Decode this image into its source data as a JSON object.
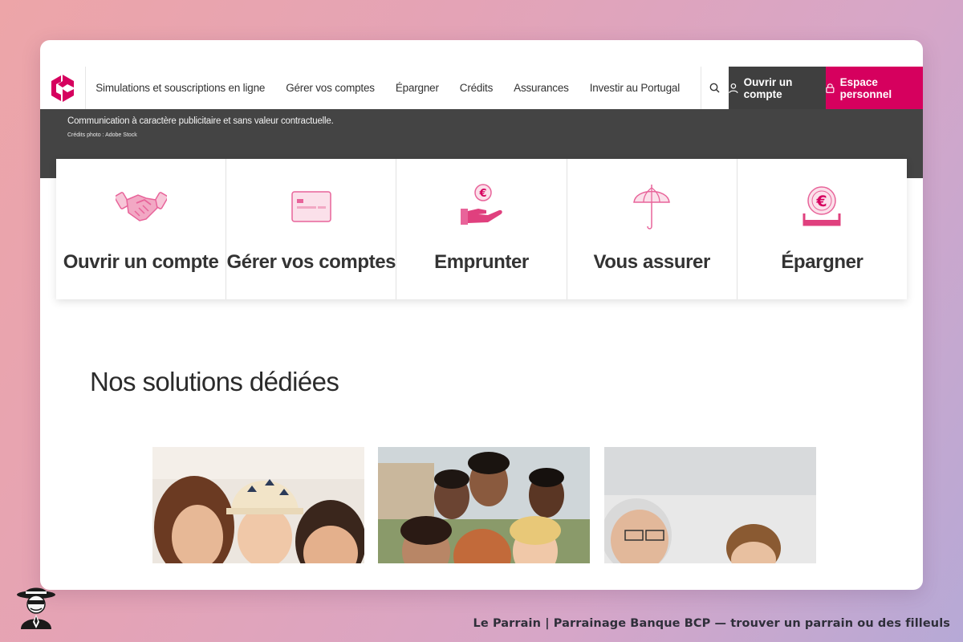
{
  "header": {
    "logo_icon": "bcp-logo-icon",
    "nav": [
      {
        "label": "Simulations et souscriptions en ligne"
      },
      {
        "label": "Gérer vos comptes"
      },
      {
        "label": "Épargner"
      },
      {
        "label": "Crédits"
      },
      {
        "label": "Assurances"
      },
      {
        "label": "Investir au Portugal"
      }
    ],
    "search_icon": "search-icon",
    "open_account_label": "Ouvrir un compte",
    "open_account_icon": "user-icon",
    "espace_label": "Espace personnel",
    "espace_icon": "lock-icon"
  },
  "hero": {
    "disclaimer": "Communication à caractère publicitaire et sans valeur contractuelle.",
    "credit": "Crédits photo : Adobe Stock"
  },
  "tiles": [
    {
      "label": "Ouvrir un compte",
      "icon": "handshake-icon"
    },
    {
      "label": "Gérer vos comptes",
      "icon": "card-icon"
    },
    {
      "label": "Emprunter",
      "icon": "hand-euro-icon"
    },
    {
      "label": "Vous assurer",
      "icon": "umbrella-icon"
    },
    {
      "label": "Épargner",
      "icon": "euro-coin-icon"
    }
  ],
  "solutions": {
    "title": "Nos solutions dédiées",
    "cards": [
      {
        "image": "family-photo"
      },
      {
        "image": "friends-photo"
      },
      {
        "image": "seniors-photo"
      }
    ]
  },
  "footer": {
    "text": "Le Parrain | Parrainage Banque BCP — trouver un parrain ou des filleuls",
    "mascot_icon": "parrain-mascot-icon"
  },
  "colors": {
    "brand": "#d6005e",
    "icon_pink": "#e8649a",
    "dark_bar": "#444444",
    "button_dark": "#3f3f3f"
  }
}
